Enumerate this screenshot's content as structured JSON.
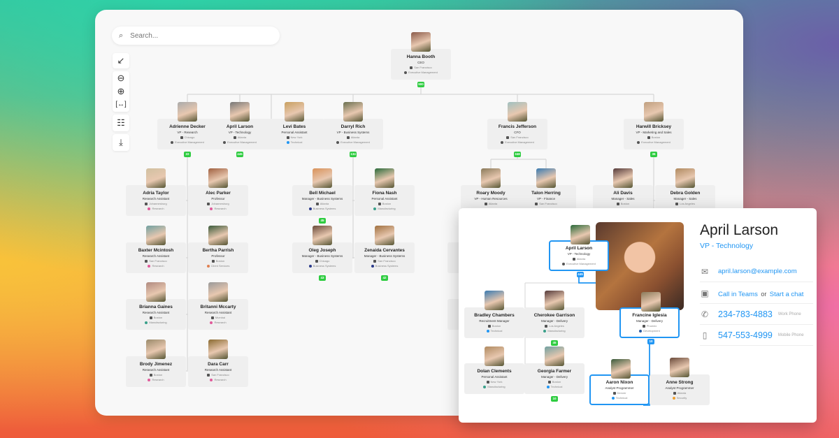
{
  "search": {
    "placeholder": "Search..."
  },
  "toolbar": {
    "collapse": "collapse-icon",
    "zoom_out": "zoom-out-icon",
    "zoom_in": "zoom-in-icon",
    "fit": "fit-width-icon",
    "layout": "layout-icon",
    "export": "download-icon"
  },
  "colors": {
    "accent": "#2196f3",
    "badge": "#2ecc40"
  },
  "chart_nodes": [
    {
      "name": "Hanna Booth",
      "title": "CEO",
      "location": "San Francisco",
      "department": "Executive Management",
      "count": "900"
    },
    {
      "name": "Adrienne Decker",
      "title": "VP - Research",
      "location": "Chicago",
      "department": "Executive Management",
      "count": "22"
    },
    {
      "name": "April Larson",
      "title": "VP - Technology",
      "location": "Atlanta",
      "department": "Executive Management",
      "count": "445"
    },
    {
      "name": "Levi Bates",
      "title": "Personal Assistant",
      "location": "New York",
      "department": "Technical"
    },
    {
      "name": "Darryl Rich",
      "title": "VP - Business Systems",
      "location": "Atlanta",
      "department": "Executive Management",
      "count": "134"
    },
    {
      "name": "Francis Jefferson",
      "title": "CFO",
      "location": "San Francisco",
      "department": "Executive Management",
      "count": "348"
    },
    {
      "name": "Harwill Bricksey",
      "title": "VP - Marketing and Sales",
      "location": "Boston",
      "department": "Executive Management",
      "count": "36"
    },
    {
      "name": "Adria Taylor",
      "title": "Research Assistant",
      "location": "Johannesburg",
      "department": "Research"
    },
    {
      "name": "Alec Parker",
      "title": "Professor",
      "location": "Johannesburg",
      "department": "Research"
    },
    {
      "name": "Bell Michael",
      "title": "Manager - Business Systems",
      "location": "Atlanta",
      "department": "Business Systems",
      "count": "45"
    },
    {
      "name": "Fiona Nash",
      "title": "Personal Assistant",
      "location": "Boston",
      "department": "Manufacturing"
    },
    {
      "name": "Roary Moody",
      "title": "VP - Human Resources",
      "location": "Atlanta",
      "department": ""
    },
    {
      "name": "Talon Herring",
      "title": "VP - Finance",
      "location": "San Francisco",
      "department": ""
    },
    {
      "name": "Ali Davis",
      "title": "Manager - Sales",
      "location": "Boston",
      "department": ""
    },
    {
      "name": "Debra Golden",
      "title": "Manager - Sales",
      "location": "Los Angeles",
      "department": ""
    },
    {
      "name": "Baxter Mcintosh",
      "title": "Research Assistant",
      "location": "San Francisco",
      "department": "Research"
    },
    {
      "name": "Bertha Parrish",
      "title": "Professor",
      "location": "Boston",
      "department": "Client Services"
    },
    {
      "name": "Oleg Joseph",
      "title": "Manager - Business Systems",
      "location": "Chicago",
      "department": "Business Systems",
      "count": "43"
    },
    {
      "name": "Zenaida Cervantes",
      "title": "Manager - Business Systems",
      "location": "San Francisco",
      "department": "Business Systems",
      "count": "42"
    },
    {
      "name": "Davis F",
      "title": "HR Ma",
      "location": "",
      "department": ""
    },
    {
      "name": "Brianna Gaines",
      "title": "Research Assistant",
      "location": "Boston",
      "department": "Manufacturing"
    },
    {
      "name": "Britanni Mccarty",
      "title": "Research Assistant",
      "location": "Mumbai",
      "department": "Research"
    },
    {
      "name": "Lael R",
      "title": "HR Ma",
      "location": "",
      "department": ""
    },
    {
      "name": "Brody Jimenez",
      "title": "Research Assistant",
      "location": "Boston",
      "department": "Research"
    },
    {
      "name": "Dara Carr",
      "title": "Research Assistant",
      "location": "San Francisco",
      "department": "Research"
    }
  ],
  "popup": {
    "name": "April Larson",
    "title": "VP - Technology",
    "email": "april.larson@example.com",
    "email_icon": "mail-icon",
    "teams": "Call in Teams",
    "or": "or",
    "chat": "Start a chat",
    "teams_icon": "teams-icon",
    "work_phone": "234-783-4883",
    "work_label": "Work Phone",
    "phone_icon": "phone-icon",
    "mobile_phone": "547-553-4999",
    "mobile_label": "Mobile Phone",
    "mobile_icon": "mobile-icon",
    "nodes": [
      {
        "name": "April Larson",
        "title": "VP - Technology",
        "location": "Atlanta",
        "department": "Executive Management",
        "count": "445",
        "selected": true
      },
      {
        "name": "Francine Iglesia",
        "title": "Manager - Delivery",
        "location": "Phoenix",
        "department": "Development",
        "count": "10",
        "selected": true
      },
      {
        "name": "Bradley Chambers",
        "title": "Recruitment Manager",
        "location": "Boston",
        "department": "Technical"
      },
      {
        "name": "Cherokee Garrison",
        "title": "Manager - Delivery",
        "location": "Los Angeles",
        "department": "Manufacturing",
        "count": "45"
      },
      {
        "name": "Dolan Clements",
        "title": "Personal Assistant",
        "location": "New York",
        "department": "Manufacturing"
      },
      {
        "name": "Georgia Farmer",
        "title": "Manager - Delivery",
        "location": "Boston",
        "department": "Technical",
        "count": "10"
      },
      {
        "name": "Aaron Nixon",
        "title": "Analyst Programmer",
        "location": "Denver",
        "department": "Technical",
        "selected": true
      },
      {
        "name": "Anne Strong",
        "title": "Analyst Programmer",
        "location": "Atlanta",
        "department": "Security"
      }
    ]
  }
}
